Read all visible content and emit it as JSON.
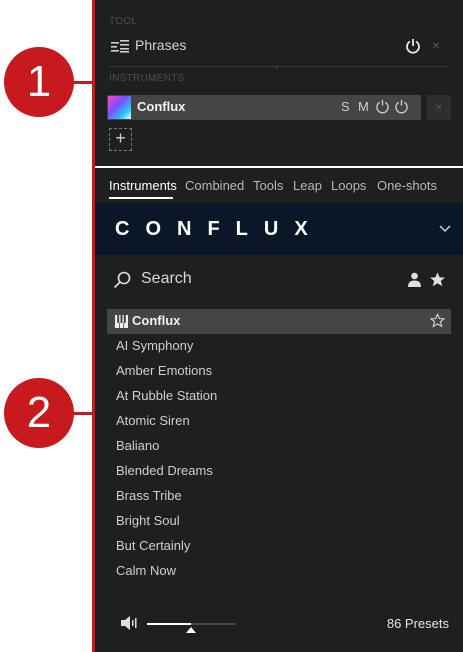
{
  "callouts": {
    "one": "1",
    "two": "2"
  },
  "tool_section": {
    "label": "TOOL",
    "tool_name": "Phrases",
    "close_glyph": "×"
  },
  "instruments_section": {
    "label": "INSTRUMENTS",
    "slot": {
      "name": "Conflux",
      "solo": "S",
      "mute": "M",
      "close_glyph": "×"
    },
    "add_glyph": "+"
  },
  "tabs": [
    {
      "label": "Instruments",
      "active": true
    },
    {
      "label": "Combined",
      "active": false
    },
    {
      "label": "Tools",
      "active": false
    },
    {
      "label": "Leap",
      "active": false
    },
    {
      "label": "Loops",
      "active": false
    },
    {
      "label": "One-shots",
      "active": false
    }
  ],
  "brand": {
    "name": "CONFLUX"
  },
  "search": {
    "placeholder": "Search"
  },
  "preset_list": {
    "header": "Conflux",
    "items": [
      "AI Symphony",
      "Amber Emotions",
      "At Rubble Station",
      "Atomic Siren",
      "Baliano",
      "Blended Dreams",
      "Brass Tribe",
      "Bright Soul",
      "But Certainly",
      "Calm Now"
    ]
  },
  "footer": {
    "volume_level": 0.5,
    "preset_count": "86 Presets"
  },
  "icons": {
    "tool": "phrases-icon",
    "power": "power-icon",
    "search": "search-icon",
    "user": "user-icon",
    "favorites": "star-icon",
    "piano": "piano-icon",
    "speaker": "speaker-icon",
    "chevron": "chevron-down-icon"
  },
  "colors": {
    "panel_bg": "#1f1f1f",
    "selected_row": "#454545",
    "brand_bg": "#0b1729",
    "callout": "#c8191e"
  }
}
